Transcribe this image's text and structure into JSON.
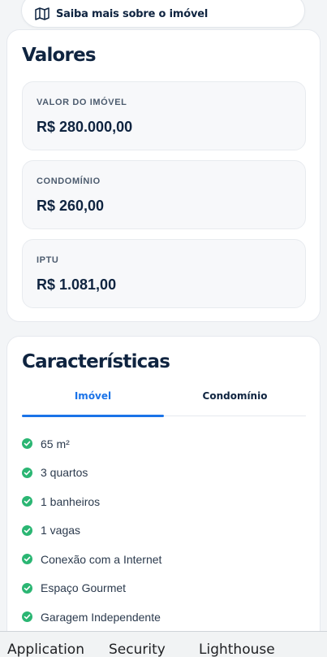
{
  "top_button": {
    "label": "Saiba mais sobre o imóvel",
    "icon": "map-icon"
  },
  "values": {
    "title": "Valores",
    "items": [
      {
        "label": "VALOR DO IMÓVEL",
        "amount": "R$ 280.000,00"
      },
      {
        "label": "CONDOMÍNIO",
        "amount": "R$ 260,00"
      },
      {
        "label": "IPTU",
        "amount": "R$ 1.081,00"
      }
    ]
  },
  "features": {
    "title": "Características",
    "tabs": [
      {
        "label": "Imóvel",
        "active": true
      },
      {
        "label": "Condomínio",
        "active": false
      }
    ],
    "items": [
      "65 m²",
      "3 quartos",
      "1 banheiros",
      "1 vagas",
      "Conexão com a Internet",
      "Espaço Gourmet",
      "Garagem Independente"
    ]
  },
  "devtools": {
    "tabs": [
      "Application",
      "Security",
      "Lighthouse"
    ]
  },
  "colors": {
    "accent": "#1a73e8",
    "check": "#2bb673",
    "text": "#0f2440"
  }
}
